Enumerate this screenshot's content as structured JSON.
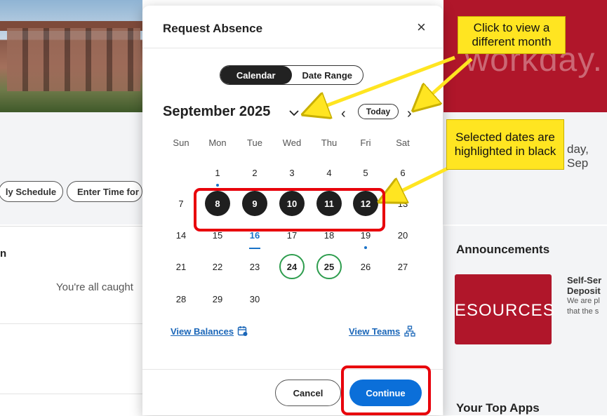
{
  "background": {
    "brand_text": "workday.",
    "date_text": "day, Sep",
    "pill_schedule": "ly Schedule",
    "pill_enter_time": "Enter Time for",
    "left_heading": "n",
    "left_message": "You're all caught",
    "announcements_title": "Announcements",
    "announcement_image_text": "ESOURCES",
    "announcement_title_line1": "Self-Ser",
    "announcement_title_line2": "Deposit",
    "announcement_body_line1": "We are pl",
    "announcement_body_line2": "that the s",
    "top_apps_title": "Your Top Apps"
  },
  "modal": {
    "title": "Request Absence",
    "close_glyph": "×",
    "toggle": {
      "calendar_label": "Calendar",
      "date_range_label": "Date Range",
      "selected": "calendar"
    },
    "month_label": "September 2025",
    "today_label": "Today",
    "prev_glyph": "‹",
    "next_glyph": "›",
    "weekdays": [
      "Sun",
      "Mon",
      "Tue",
      "Wed",
      "Thu",
      "Fri",
      "Sat"
    ],
    "days": [
      {
        "d": "1",
        "state": "dot"
      },
      {
        "d": "2"
      },
      {
        "d": "3"
      },
      {
        "d": "4"
      },
      {
        "d": "5"
      },
      {
        "d": "6"
      },
      {
        "d": "7"
      },
      {
        "d": "8",
        "state": "selected"
      },
      {
        "d": "9",
        "state": "selected"
      },
      {
        "d": "10",
        "state": "selected"
      },
      {
        "d": "11",
        "state": "selected"
      },
      {
        "d": "12",
        "state": "selected"
      },
      {
        "d": "13"
      },
      {
        "d": "14"
      },
      {
        "d": "15"
      },
      {
        "d": "16",
        "state": "today"
      },
      {
        "d": "17"
      },
      {
        "d": "18"
      },
      {
        "d": "19",
        "state": "dot"
      },
      {
        "d": "20"
      },
      {
        "d": "21"
      },
      {
        "d": "22"
      },
      {
        "d": "23"
      },
      {
        "d": "24",
        "state": "ring"
      },
      {
        "d": "25",
        "state": "ring"
      },
      {
        "d": "26"
      },
      {
        "d": "27"
      },
      {
        "d": "28"
      },
      {
        "d": "29"
      },
      {
        "d": "30"
      }
    ],
    "first_weekday_index": 1,
    "view_balances_label": "View Balances",
    "view_teams_label": "View Teams",
    "cancel_label": "Cancel",
    "continue_label": "Continue"
  },
  "annotations": {
    "callout_month": "Click to view a different month",
    "callout_selected": "Selected dates are highlighted in black"
  },
  "colors": {
    "brand_red": "#b0162a",
    "selected_day": "#1f1f1f",
    "ring_green": "#2e9d4e",
    "link_blue": "#1a66b8",
    "continue_blue": "#0b6fd9",
    "callout_yellow": "#ffe521",
    "highlight_red": "#e8000b"
  }
}
